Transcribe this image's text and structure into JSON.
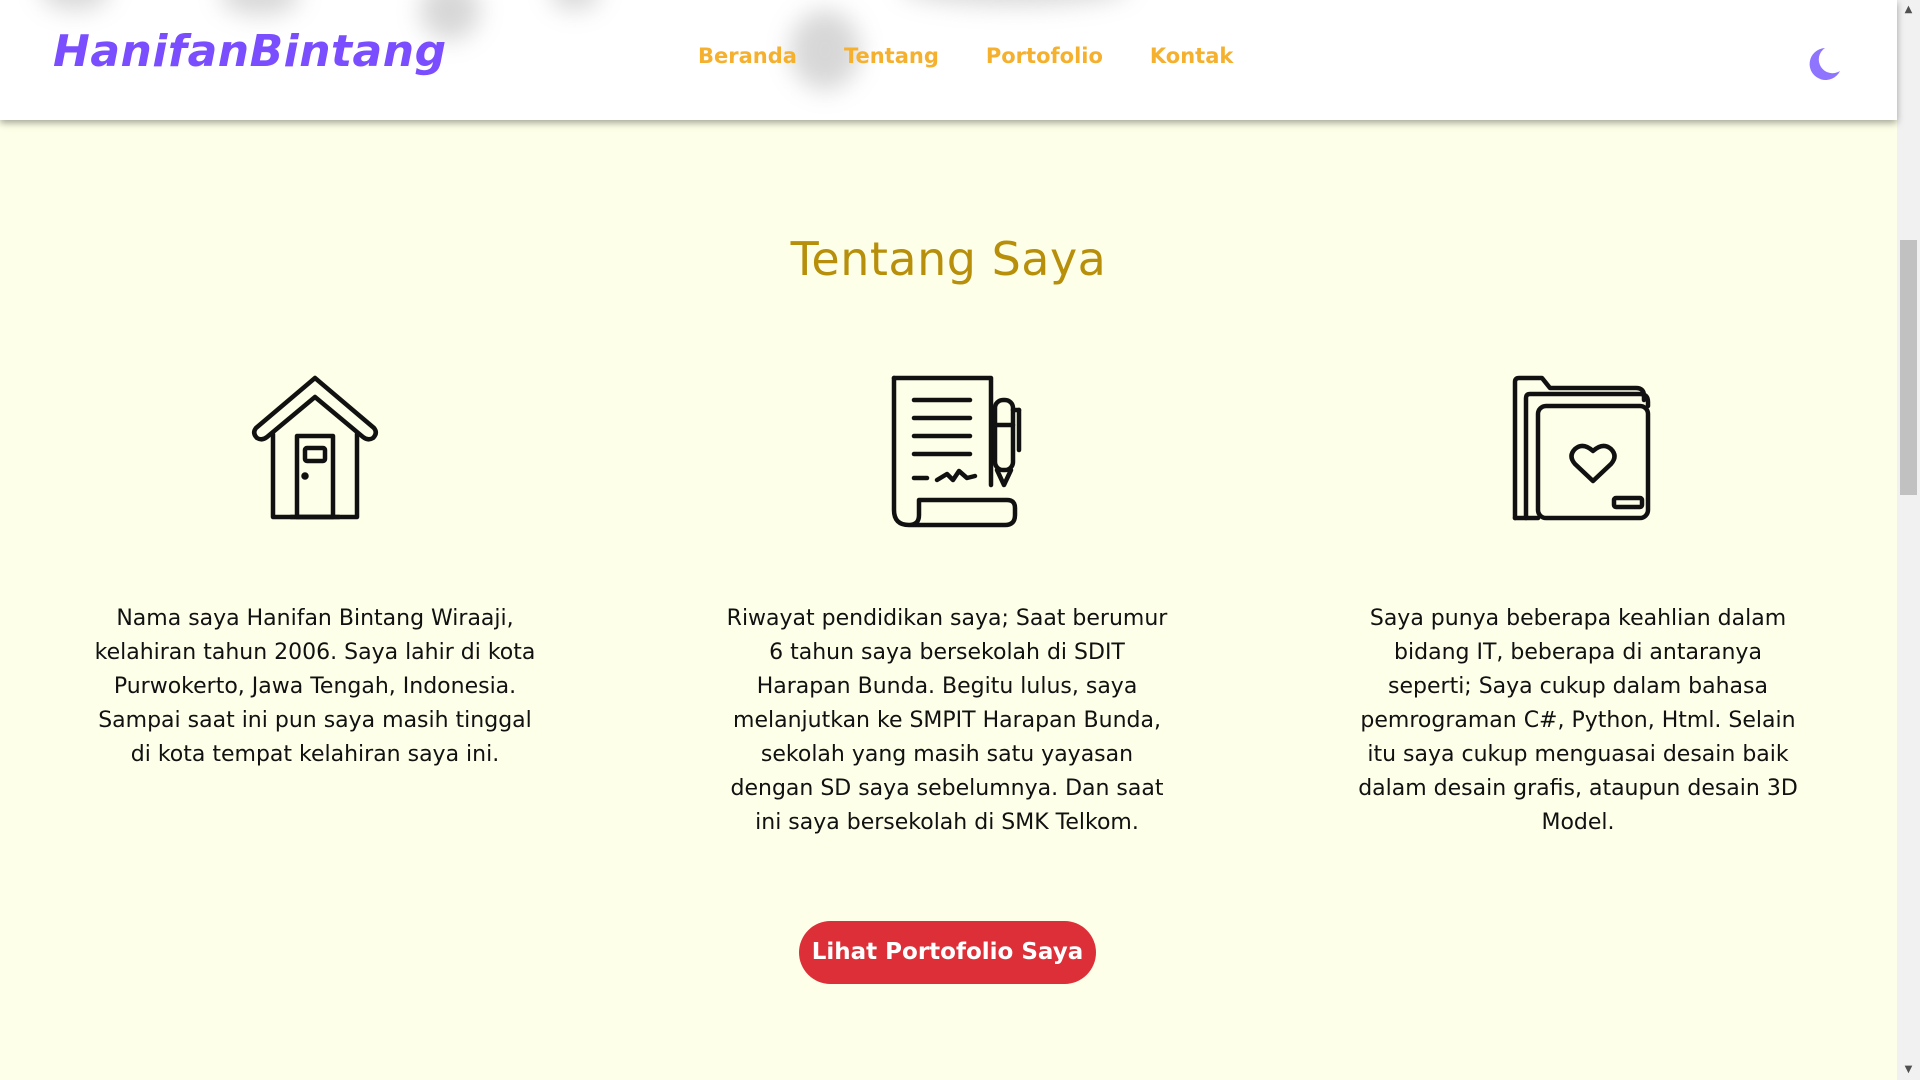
{
  "brand": {
    "name": "HanifanBintang"
  },
  "nav": {
    "items": [
      {
        "label": "Beranda"
      },
      {
        "label": "Tentang"
      },
      {
        "label": "Portofolio"
      },
      {
        "label": "Kontak"
      }
    ],
    "theme_toggle_icon": "moon-icon"
  },
  "colors": {
    "brand": "#7a4dff",
    "nav_link": "#f5b02e",
    "title": "#b88f0a",
    "background": "#fdffe8",
    "button": "#dc2f37"
  },
  "about": {
    "title": "Tentang Saya",
    "columns": [
      {
        "icon": "house-icon",
        "text": "Nama saya Hanifan Bintang Wiraaji, kelahiran tahun 2006. Saya lahir di kota Purwokerto, Jawa Tengah, Indonesia. Sampai saat ini pun saya masih tinggal di kota tempat kelahiran saya ini."
      },
      {
        "icon": "certificate-scroll-icon",
        "text": "Riwayat pendidikan saya; Saat berumur 6 tahun saya bersekolah di SDIT Harapan Bunda. Begitu lulus, saya melanjutkan ke SMPIT Harapan Bunda, sekolah yang masih satu yayasan dengan SD saya sebelumnya. Dan saat ini saya bersekolah di SMK Telkom."
      },
      {
        "icon": "folder-heart-icon",
        "text": "Saya punya beberapa keahlian dalam bidang IT, beberapa di antaranya seperti; Saya cukup dalam bahasa pemrograman C#, Python, Html. Selain itu saya cukup menguasai desain baik dalam desain grafis, ataupun desain 3D Model."
      }
    ],
    "cta_label": "Lihat Portofolio Saya"
  }
}
